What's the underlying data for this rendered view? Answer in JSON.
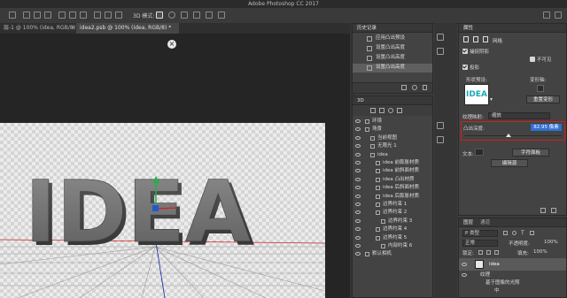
{
  "app": {
    "title": "Adobe Photoshop CC 2017",
    "mode_label": "3D 模式:"
  },
  "tabs": [
    {
      "label": "层-1 @ 100% (idea, RGB/8) *"
    },
    {
      "label": "idea2.psb @ 100% (idea, RGB/8) *"
    }
  ],
  "canvas": {
    "text": "IDEA"
  },
  "history": {
    "title": "历史记录",
    "items": [
      {
        "label": "应用凸出预设"
      },
      {
        "label": "设置凸出高度"
      },
      {
        "label": "设置凸出高度"
      },
      {
        "label": "设置凸出高度"
      }
    ],
    "selected_index": 3
  },
  "panel3d": {
    "title": "3D",
    "items": [
      {
        "label": "环境",
        "indent": 0
      },
      {
        "label": "场景",
        "indent": 0
      },
      {
        "label": "当前视图",
        "indent": 1
      },
      {
        "label": "无限光 1",
        "indent": 1
      },
      {
        "label": "idea",
        "indent": 1
      },
      {
        "label": "idea 前膨胀材质",
        "indent": 2
      },
      {
        "label": "idea 前斜面材质",
        "indent": 2
      },
      {
        "label": "idea 凸出材质",
        "indent": 2
      },
      {
        "label": "idea 后斜面材质",
        "indent": 2
      },
      {
        "label": "idea 后膨胀材质",
        "indent": 2
      },
      {
        "label": "边界约束 1",
        "indent": 2
      },
      {
        "label": "边界约束 2",
        "indent": 2
      },
      {
        "label": "边界约束 3",
        "indent": 3
      },
      {
        "label": "边界约束 4",
        "indent": 2
      },
      {
        "label": "边界约束 5",
        "indent": 2
      },
      {
        "label": "内部约束 6",
        "indent": 3
      },
      {
        "label": "默认相机",
        "indent": 0
      }
    ]
  },
  "properties": {
    "tab1": "属性",
    "section_label": "网格",
    "check_capture_shadow": "捕捉阴影",
    "check_invisible": "不可见",
    "check_cast_shadow": "投影",
    "shape_preset_label": "形状预设:",
    "deform_axis_label": "变形轴:",
    "reset_deform_button": "重置变形",
    "thumbnail_text": "IDEA",
    "texture_mapping_label": "纹理映射:",
    "texture_mapping_value": "缩放",
    "extrusion_depth_label": "凸出深度:",
    "extrusion_depth_value": "82.95 像素",
    "extrusion_fraction": 0.45,
    "text_label": "文本:",
    "char_panel_button": "字符面板",
    "edit_source_button": "编辑源"
  },
  "layers": {
    "tab_layers": "图层",
    "tab_channels": "通道",
    "filter_value": "P 类型",
    "blend_mode": "正常",
    "opacity_label": "不透明度:",
    "opacity_value": "100%",
    "lock_label": "锁定:",
    "fill_label": "填充:",
    "fill_value": "100%",
    "items": [
      {
        "label": "idea"
      },
      {
        "label": "纹理"
      },
      {
        "label": "基于图像的光照"
      },
      {
        "label": "中"
      }
    ]
  },
  "colors": {
    "highlight_border": "#d21e1e",
    "value_box": "#2f6fd0",
    "thumb_accent": "#1aa7b8"
  }
}
